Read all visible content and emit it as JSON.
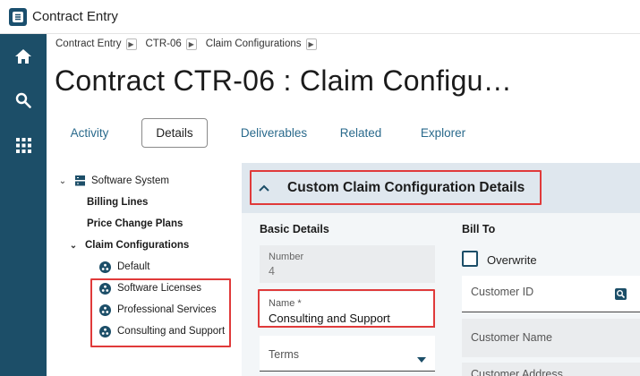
{
  "window": {
    "title": "Contract Entry",
    "logo_letter": "e"
  },
  "rail": {
    "items": [
      "home",
      "search",
      "apps"
    ]
  },
  "breadcrumb": [
    {
      "label": "Contract Entry"
    },
    {
      "label": "CTR-06"
    },
    {
      "label": "Claim Configurations"
    }
  ],
  "page": {
    "title": "Contract CTR-06 : Claim Configu…"
  },
  "tabs": [
    {
      "label": "Activity"
    },
    {
      "label": "Details",
      "active": true
    },
    {
      "label": "Deliverables"
    },
    {
      "label": "Related"
    },
    {
      "label": "Explorer"
    }
  ],
  "tree": {
    "root": "Software System",
    "billing_lines": "Billing Lines",
    "price_change_plans": "Price Change Plans",
    "claim_configurations": "Claim Configurations",
    "children": [
      "Default",
      "Software Licenses",
      "Professional Services",
      "Consulting and Support"
    ]
  },
  "section": {
    "title": "Custom Claim Configuration Details"
  },
  "basic_details": {
    "heading": "Basic Details",
    "number_label": "Number",
    "number_value": "4",
    "name_label": "Name *",
    "name_value": "Consulting and Support",
    "terms_label": "Terms"
  },
  "bill_to": {
    "heading": "Bill To",
    "overwrite_label": "Overwrite",
    "customer_id_label": "Customer ID",
    "customer_name_label": "Customer Name",
    "customer_address_label": "Customer Address"
  },
  "colors": {
    "rail": "#1c4e68",
    "accent": "#2a6a8c",
    "highlight": "#e03a3a"
  }
}
